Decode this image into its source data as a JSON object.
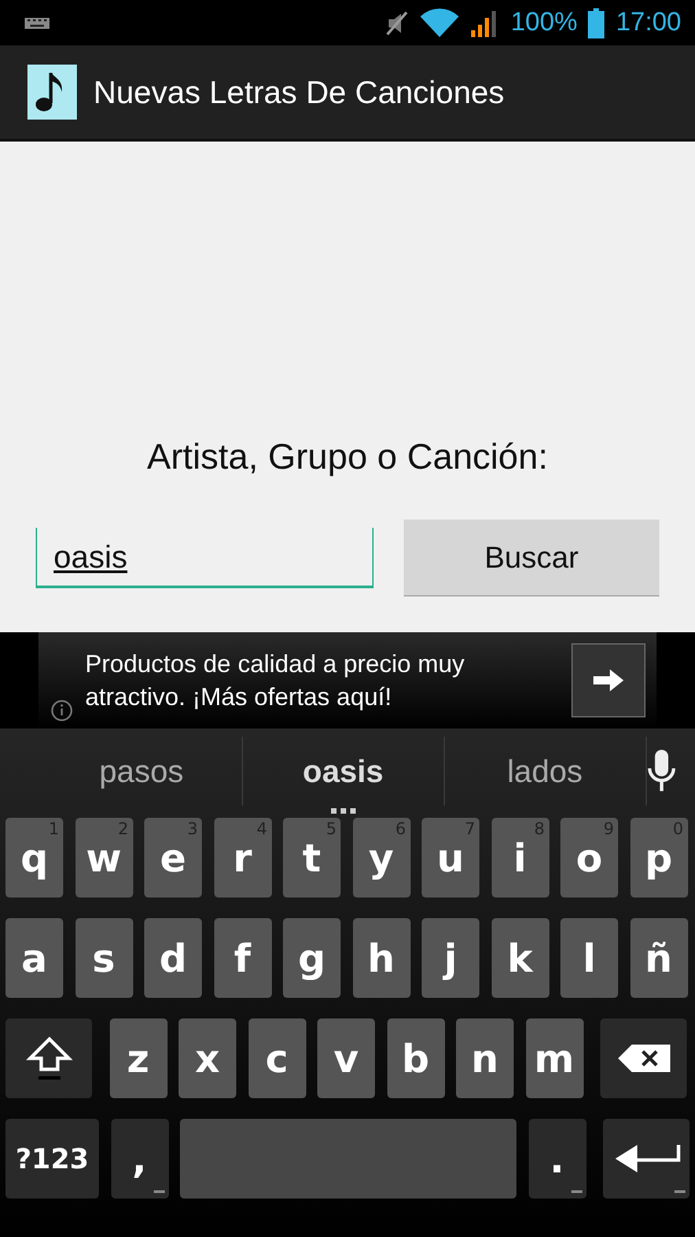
{
  "status_bar": {
    "battery": "100%",
    "time": "17:00"
  },
  "action_bar": {
    "title": "Nuevas Letras De Canciones"
  },
  "form": {
    "label": "Artista, Grupo o Canción:",
    "search": {
      "value": "oasis"
    },
    "button": "Buscar"
  },
  "ad": {
    "text": "Productos de calidad a precio muy atractivo. ¡Más ofertas aquí!"
  },
  "keyboard": {
    "suggestions": [
      {
        "text": "pasos",
        "selected": false
      },
      {
        "text": "oasis",
        "selected": true
      },
      {
        "text": "lados",
        "selected": false
      }
    ],
    "rows": [
      [
        {
          "kind": "letter",
          "label": "q",
          "hint": "1"
        },
        {
          "kind": "letter",
          "label": "w",
          "hint": "2"
        },
        {
          "kind": "letter",
          "label": "e",
          "hint": "3"
        },
        {
          "kind": "letter",
          "label": "r",
          "hint": "4"
        },
        {
          "kind": "letter",
          "label": "t",
          "hint": "5"
        },
        {
          "kind": "letter",
          "label": "y",
          "hint": "6"
        },
        {
          "kind": "letter",
          "label": "u",
          "hint": "7"
        },
        {
          "kind": "letter",
          "label": "i",
          "hint": "8"
        },
        {
          "kind": "letter",
          "label": "o",
          "hint": "9"
        },
        {
          "kind": "letter",
          "label": "p",
          "hint": "0"
        }
      ],
      [
        {
          "kind": "letter",
          "label": "a"
        },
        {
          "kind": "letter",
          "label": "s"
        },
        {
          "kind": "letter",
          "label": "d"
        },
        {
          "kind": "letter",
          "label": "f"
        },
        {
          "kind": "letter",
          "label": "g"
        },
        {
          "kind": "letter",
          "label": "h"
        },
        {
          "kind": "letter",
          "label": "j"
        },
        {
          "kind": "letter",
          "label": "k"
        },
        {
          "kind": "letter",
          "label": "l"
        },
        {
          "kind": "letter",
          "label": "ñ"
        }
      ],
      [
        {
          "kind": "shift"
        },
        {
          "kind": "letter",
          "label": "z"
        },
        {
          "kind": "letter",
          "label": "x"
        },
        {
          "kind": "letter",
          "label": "c"
        },
        {
          "kind": "letter",
          "label": "v"
        },
        {
          "kind": "letter",
          "label": "b"
        },
        {
          "kind": "letter",
          "label": "n"
        },
        {
          "kind": "letter",
          "label": "m"
        },
        {
          "kind": "delete"
        }
      ],
      [
        {
          "kind": "symbols",
          "label": "?123"
        },
        {
          "kind": "comma",
          "label": ","
        },
        {
          "kind": "space"
        },
        {
          "kind": "period",
          "label": "."
        },
        {
          "kind": "enter"
        }
      ]
    ]
  }
}
